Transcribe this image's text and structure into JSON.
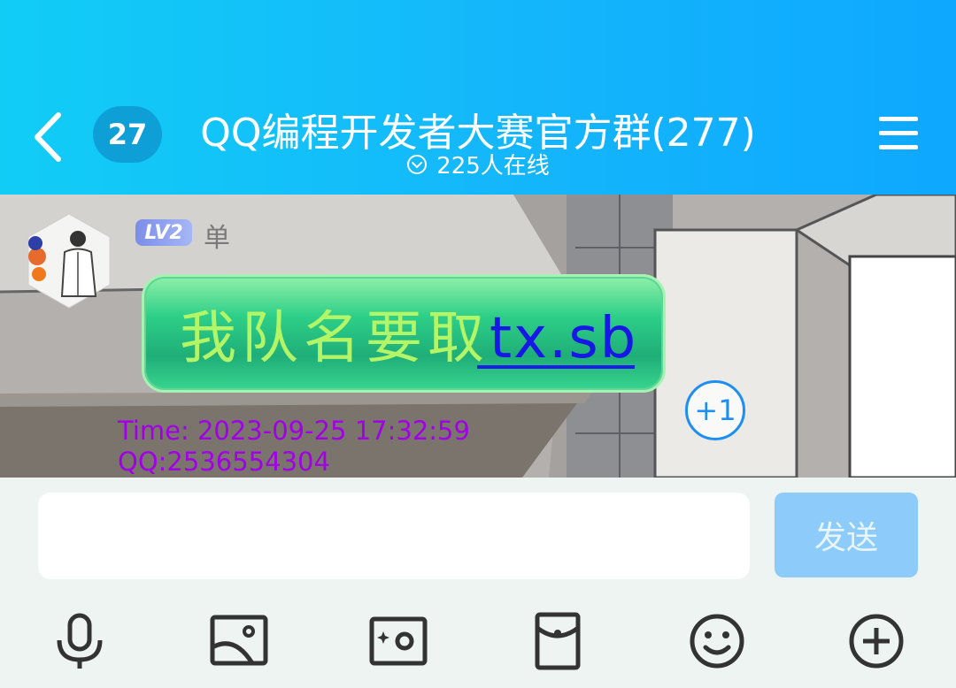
{
  "header": {
    "unread_count": "27",
    "title": "QQ编程开发者大赛官方群(277)",
    "online": "225人在线"
  },
  "message": {
    "level": "LV2",
    "sender": "单",
    "text": "我队名要取",
    "link_text": "tx.sb",
    "reaction": "+1",
    "time_line": "Time: 2023-09-25 17:32:59",
    "qq_line": "QQ:2536554304"
  },
  "composer": {
    "input_value": "",
    "send_label": "发送"
  },
  "toolbar": {
    "icons": [
      "microphone-icon",
      "image-icon",
      "camera-icon",
      "red-packet-icon",
      "emoji-icon",
      "plus-icon"
    ]
  },
  "colors": {
    "header_start": "#11cdf6",
    "header_end": "#0ea8ff",
    "send_button": "#8dccfa",
    "meta_text": "#a100e6",
    "link_text": "#1717e6"
  }
}
